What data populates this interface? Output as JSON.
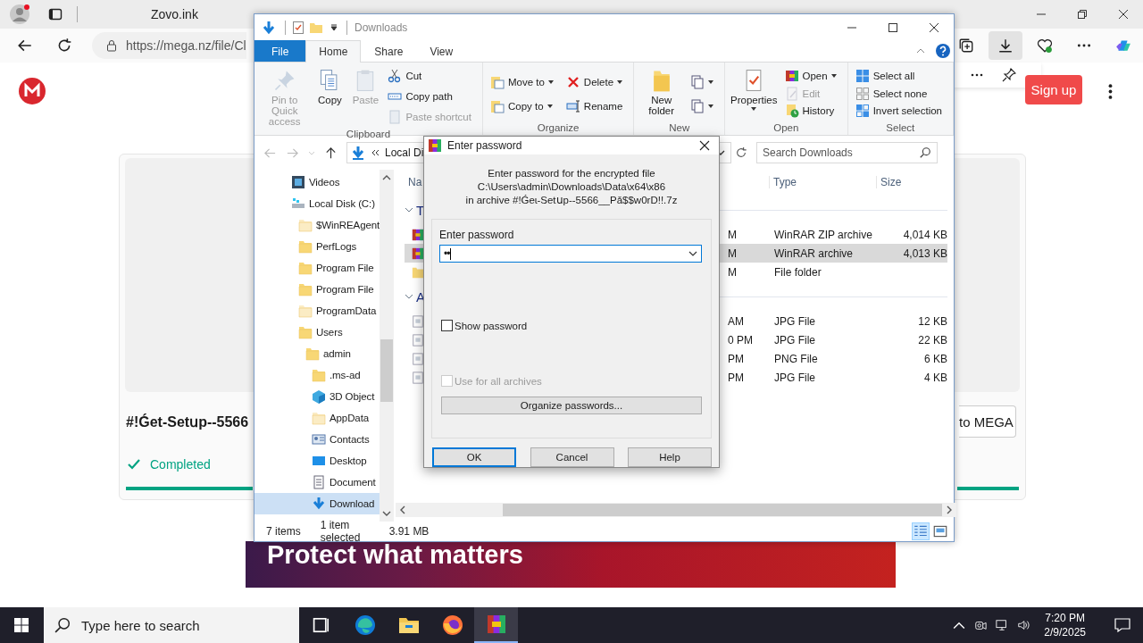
{
  "browser": {
    "tabs": [
      {
        "title": "Zovo.ink",
        "selected": false
      }
    ],
    "address": "https://mega.nz/file/Cl"
  },
  "mega": {
    "signup": "Sign up",
    "file_name": "#!Ǵet-Setսp--5566",
    "import_button": "to MEGA",
    "status": "Completed",
    "progress": {
      "level": 1
    },
    "banner": "Protect what matters"
  },
  "explorer": {
    "title": "Downloads",
    "ribbon_tabs": [
      {
        "label": "File",
        "kind": "file",
        "selected": false
      },
      {
        "label": "Home",
        "kind": "tab",
        "selected": true
      },
      {
        "label": "Share",
        "kind": "tab",
        "selected": false
      },
      {
        "label": "View",
        "kind": "tab",
        "selected": false
      }
    ],
    "groups": [
      {
        "label": "Clipboard",
        "large": [
          {
            "label": "Pin to Quick access",
            "disabled": true
          },
          {
            "label": "Copy",
            "disabled": false
          },
          {
            "label": "Paste",
            "disabled": true
          }
        ],
        "small_columns": [
          [
            {
              "label": "Cut",
              "disabled": false
            },
            {
              "label": "Copy path",
              "disabled": false
            },
            {
              "label": "Paste shortcut",
              "disabled": true
            }
          ]
        ]
      },
      {
        "label": "Organize",
        "small_columns": [
          [
            {
              "label": "Move to",
              "disabled": false,
              "dropdown": true
            },
            {
              "label": "Copy to",
              "disabled": false,
              "dropdown": true
            }
          ],
          [
            {
              "label": "Delete",
              "disabled": false,
              "dropdown": true
            },
            {
              "label": "Rename",
              "disabled": false
            }
          ]
        ]
      },
      {
        "label": "New",
        "large": [
          {
            "label": "New folder",
            "disabled": false
          }
        ],
        "small_columns": [
          [
            {
              "disabled": false,
              "dropdown": true
            },
            {
              "disabled": false,
              "dropdown": true
            }
          ]
        ]
      },
      {
        "label": "Open",
        "large": [
          {
            "label": "Properties",
            "disabled": false,
            "dropdown": true
          }
        ],
        "small_columns": [
          [
            {
              "label": "Open",
              "disabled": false,
              "dropdown": true
            },
            {
              "label": "Edit",
              "disabled": true
            },
            {
              "label": "History",
              "disabled": false
            }
          ]
        ]
      },
      {
        "label": "Select",
        "small_columns": [
          [
            {
              "label": "Select all",
              "disabled": false
            },
            {
              "label": "Select none",
              "disabled": false
            },
            {
              "label": "Invert selection",
              "disabled": false
            }
          ]
        ]
      }
    ],
    "path": "Local Di",
    "search": {
      "placeholder": "Search Downloads"
    },
    "nav": [
      {
        "label": "Videos",
        "kind": "videos",
        "selected": false
      },
      {
        "label": "Local Disk (C:)",
        "kind": "drive",
        "selected": false,
        "children": [
          {
            "label": "$WinREAgent",
            "kind": "hidden",
            "selected": false
          },
          {
            "label": "PerfLogs",
            "kind": "folder",
            "selected": false
          },
          {
            "label": "Program File",
            "kind": "folder",
            "selected": false
          },
          {
            "label": "Program File",
            "kind": "folder",
            "selected": false
          },
          {
            "label": "ProgramData",
            "kind": "hidden",
            "selected": false
          },
          {
            "label": "Users",
            "kind": "folder",
            "selected": false,
            "children": [
              {
                "label": "admin",
                "kind": "folder",
                "selected": false,
                "children": [
                  {
                    "label": ".ms-ad",
                    "kind": "folder",
                    "selected": false
                  },
                  {
                    "label": "3D Object",
                    "kind": "cube",
                    "selected": false
                  },
                  {
                    "label": "AppData",
                    "kind": "hidden",
                    "selected": false
                  },
                  {
                    "label": "Contacts",
                    "kind": "contacts",
                    "selected": false
                  },
                  {
                    "label": "Desktop",
                    "kind": "desktop",
                    "selected": false
                  },
                  {
                    "label": "Document",
                    "kind": "documents",
                    "selected": false
                  },
                  {
                    "label": "Download",
                    "kind": "downloads",
                    "selected": true
                  }
                ]
              }
            ]
          }
        ]
      }
    ],
    "columns": [
      "Na",
      "Type",
      "Size"
    ],
    "file_groups": [
      {
        "label": "T",
        "rows": [
          {
            "kind": "archive",
            "date": "M",
            "type": "WinRAR ZIP archive",
            "size": "4,014 KB",
            "selected": false
          },
          {
            "kind": "archive",
            "date": "M",
            "type": "WinRAR archive",
            "size": "4,013 KB",
            "selected": true
          },
          {
            "kind": "folder",
            "date": "M",
            "type": "File folder",
            "selected": false
          }
        ]
      },
      {
        "label": "A",
        "rows": [
          {
            "kind": "image",
            "date": "AM",
            "type": "JPG File",
            "size": "12 KB",
            "selected": false
          },
          {
            "kind": "image",
            "date": "0 PM",
            "type": "JPG File",
            "size": "22 KB",
            "selected": false
          },
          {
            "kind": "image",
            "date": "PM",
            "type": "PNG File",
            "size": "6 KB",
            "selected": false
          },
          {
            "kind": "image",
            "date": "PM",
            "type": "JPG File",
            "size": "4 KB",
            "selected": false
          }
        ]
      }
    ],
    "status": {
      "count": "7 items",
      "selection": "1 item selected",
      "size": "3.91 MB"
    }
  },
  "dialog": {
    "title": "Enter password",
    "message": [
      "Enter password for the encrypted file",
      "C:\\Users\\admin\\Downloads\\Data\\x64\\x86",
      "in archive #!Ǵeɩ-Setսp--5566__Pǎ$$w0rD!!.7z"
    ],
    "label": "Enter password",
    "value": "••",
    "checks": [
      {
        "label": "Show password",
        "checked": false,
        "disabled": false
      },
      {
        "label": "Use for all archives",
        "checked": false,
        "disabled": true
      }
    ],
    "organize": "Organize passwords...",
    "buttons": [
      {
        "label": "OK",
        "default": true
      },
      {
        "label": "Cancel",
        "default": false
      },
      {
        "label": "Help",
        "default": false
      }
    ]
  },
  "taskbar": {
    "search": {
      "placeholder": "Type here to search"
    },
    "apps": [
      {
        "kind": "taskview",
        "active": false
      },
      {
        "kind": "edge",
        "active": false
      },
      {
        "kind": "explorer",
        "active": false
      },
      {
        "kind": "firefox",
        "active": false
      },
      {
        "kind": "winrar",
        "active": true
      }
    ],
    "time": "7:20 PM",
    "date": "2/9/2025"
  }
}
